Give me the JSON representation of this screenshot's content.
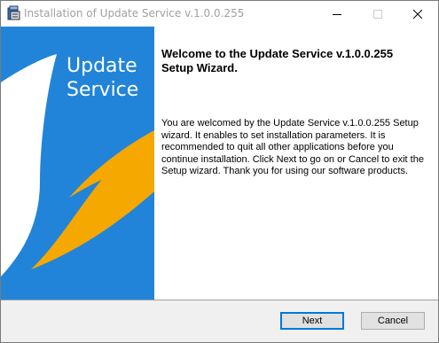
{
  "window": {
    "title": "Installation of Update Service v.1.0.0.255"
  },
  "titlebar_buttons": {
    "minimize_icon": "minimize-icon",
    "maximize_icon": "maximize-icon",
    "close_icon": "close-icon"
  },
  "side_panel": {
    "brand_line1": "Update",
    "brand_line2": "Service",
    "colors": {
      "background": "#2184d8",
      "accent": "#f5a800",
      "white": "#ffffff"
    }
  },
  "main": {
    "heading": "Welcome to the Update Service v.1.0.0.255 Setup Wizard.",
    "body": "You are welcomed by the Update Service v.1.0.0.255 Setup wizard. It enables to set installation parameters. It is recommended to quit all other applications before you continue installation. Click Next to go on or Cancel to exit the Setup wizard. Thank you for using our software products."
  },
  "footer": {
    "next_label": "Next",
    "cancel_label": "Cancel"
  }
}
